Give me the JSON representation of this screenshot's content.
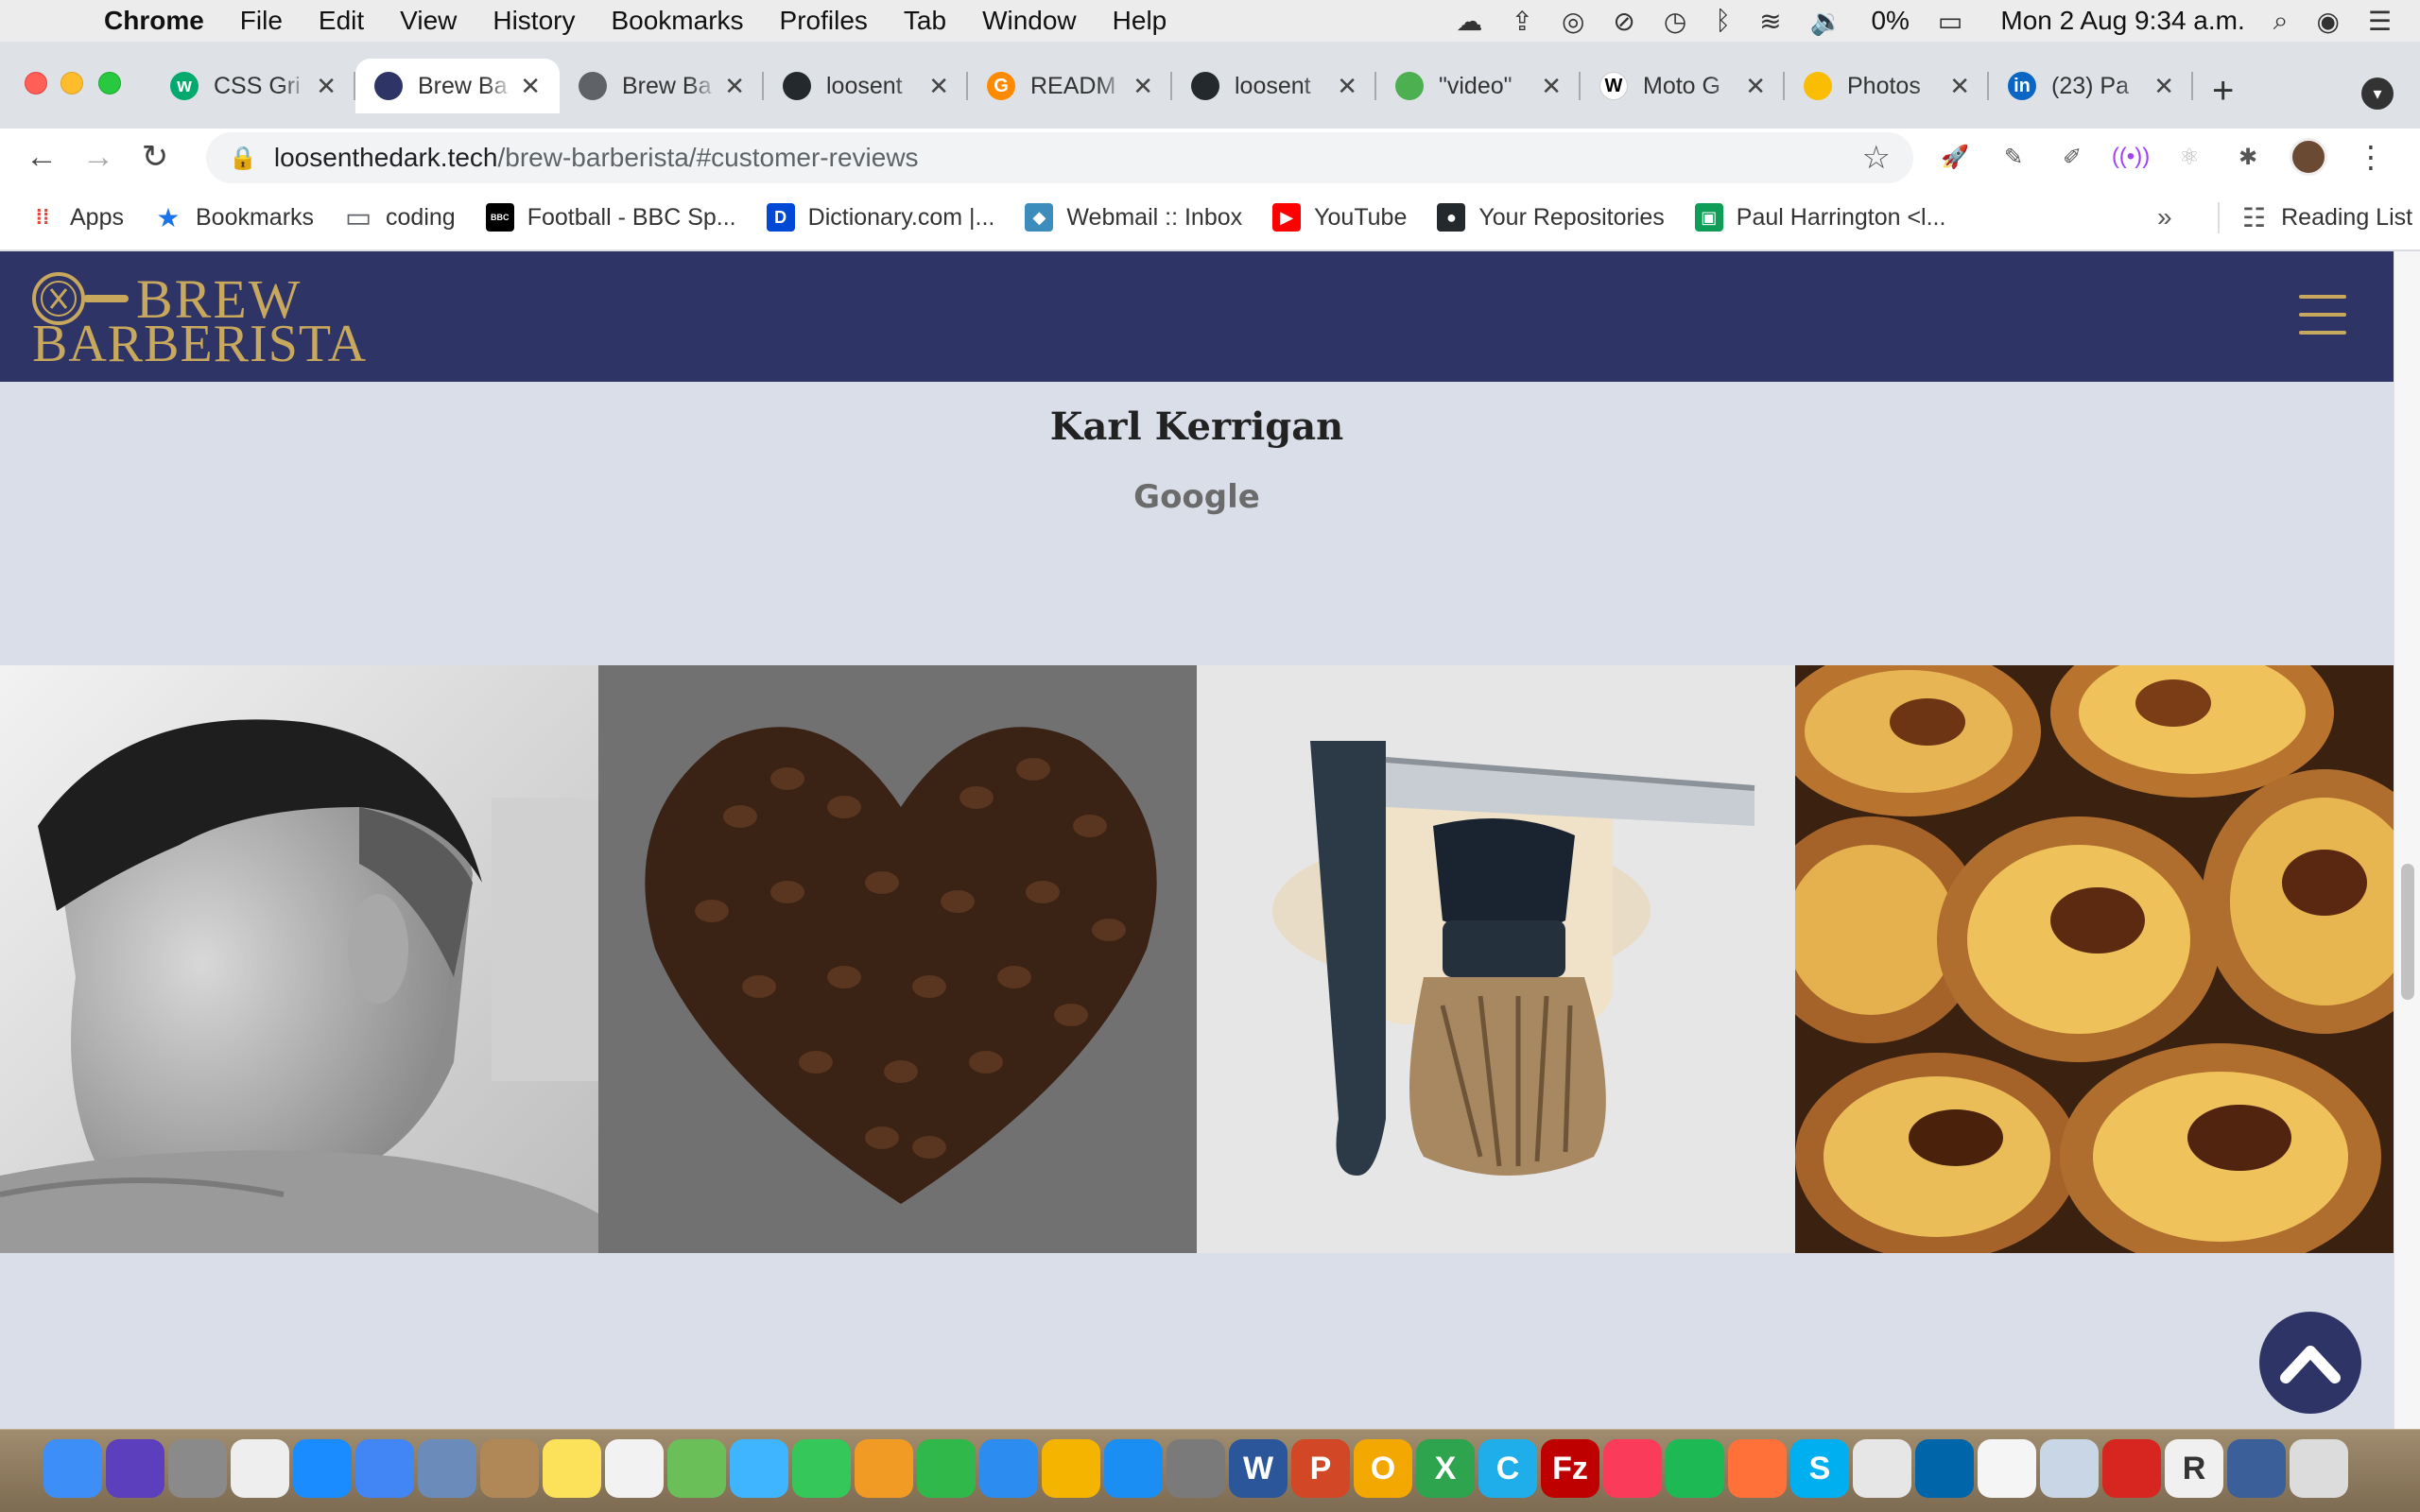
{
  "menubar": {
    "app_name": "Chrome",
    "items": [
      "File",
      "Edit",
      "View",
      "History",
      "Bookmarks",
      "Profiles",
      "Tab",
      "Window",
      "Help"
    ],
    "battery": "0%",
    "datetime": "Mon 2 Aug  9:34 a.m."
  },
  "tabs": [
    {
      "label": "CSS Gri",
      "icon": "w3schools-icon",
      "color": "#04aa6d",
      "glyph": "w"
    },
    {
      "label": "Brew Ba",
      "icon": "brew-barberista-icon",
      "color": "#2e3466",
      "glyph": "",
      "active": true
    },
    {
      "label": "Brew Ba",
      "icon": "globe-icon",
      "color": "#5f6368",
      "glyph": ""
    },
    {
      "label": "loosent",
      "icon": "github-icon",
      "color": "#24292e",
      "glyph": ""
    },
    {
      "label": "READM",
      "icon": "gitpod-icon",
      "color": "#ff8a00",
      "glyph": "G"
    },
    {
      "label": "loosent",
      "icon": "github-icon",
      "color": "#24292e",
      "glyph": ""
    },
    {
      "label": "\"video\"",
      "icon": "chart-icon",
      "color": "#4caf50",
      "glyph": ""
    },
    {
      "label": "Moto G",
      "icon": "wikipedia-icon",
      "color": "#ffffff",
      "glyph": "W"
    },
    {
      "label": "Photos",
      "icon": "google-photos-icon",
      "color": "#fbbc04",
      "glyph": ""
    },
    {
      "label": "(23) Pa",
      "icon": "linkedin-icon",
      "color": "#0a66c2",
      "glyph": "in"
    }
  ],
  "omnibox": {
    "host": "loosenthedark.tech",
    "path": "/brew-barberista/#customer-reviews"
  },
  "bookmarks": [
    {
      "label": "Apps",
      "icon": "apps-grid-icon",
      "color": "#ea4335"
    },
    {
      "label": "Bookmarks",
      "icon": "star-icon",
      "color": "#1a73e8"
    },
    {
      "label": "coding",
      "icon": "folder-icon",
      "color": "#5f6368"
    },
    {
      "label": "Football - BBC Sp...",
      "icon": "bbc-icon",
      "color": "#000000"
    },
    {
      "label": "Dictionary.com |...",
      "icon": "dictionary-icon",
      "color": "#0049d7"
    },
    {
      "label": "Webmail :: Inbox",
      "icon": "webmail-icon",
      "color": "#3c8dbc"
    },
    {
      "label": "YouTube",
      "icon": "youtube-icon",
      "color": "#ff0000"
    },
    {
      "label": "Your Repositories",
      "icon": "github-icon",
      "color": "#24292e"
    },
    {
      "label": "Paul Harrington <l...",
      "icon": "computer-icon",
      "color": "#0f9d58"
    }
  ],
  "reading_list": "Reading List",
  "site": {
    "logo_top": "BREW",
    "logo_bottom": "BARBERISTA",
    "brand_color": "#2e3466",
    "accent_color": "#c8a85c",
    "review_name": "Karl Kerrigan",
    "review_source": "Google",
    "gallery": [
      {
        "name": "gallery-image-haircut",
        "alt": "haircut"
      },
      {
        "name": "gallery-image-coffee-heart",
        "alt": "coffee-heart"
      },
      {
        "name": "gallery-image-shaving-kit",
        "alt": "shaving-kit"
      },
      {
        "name": "gallery-image-custard-tarts",
        "alt": "custard-tarts"
      }
    ]
  },
  "dock": [
    {
      "icon": "finder-icon",
      "color": "#3e8ef7"
    },
    {
      "icon": "siri-icon",
      "color": "#5b3fbd"
    },
    {
      "icon": "launchpad-icon",
      "color": "#8a8a8a"
    },
    {
      "icon": "apps-icon",
      "color": "#eeeeee"
    },
    {
      "icon": "safari-icon",
      "color": "#1a8cff"
    },
    {
      "icon": "chrome-icon",
      "color": "#4285f4"
    },
    {
      "icon": "preview-icon",
      "color": "#6b8cba"
    },
    {
      "icon": "contacts-icon",
      "color": "#b08858"
    },
    {
      "icon": "notes-icon",
      "color": "#fce25a"
    },
    {
      "icon": "reminders-icon",
      "color": "#f2f2f2"
    },
    {
      "icon": "maps-icon",
      "color": "#6bbf59"
    },
    {
      "icon": "messages-icon",
      "color": "#3fb5ff"
    },
    {
      "icon": "facetime-icon",
      "color": "#35c759"
    },
    {
      "icon": "pages-icon",
      "color": "#f29b24"
    },
    {
      "icon": "numbers-icon",
      "color": "#30b94a"
    },
    {
      "icon": "keynote-icon",
      "color": "#2d8cf0"
    },
    {
      "icon": "photos-icon",
      "color": "#f4b400"
    },
    {
      "icon": "app-store-icon",
      "color": "#1b8ef3"
    },
    {
      "icon": "system-preferences-icon",
      "color": "#7a7a7a"
    },
    {
      "icon": "word-icon",
      "color": "#2b579a",
      "glyph": "W"
    },
    {
      "icon": "powerpoint-icon",
      "color": "#d24726",
      "glyph": "P"
    },
    {
      "icon": "outlook-icon",
      "color": "#f2a800",
      "glyph": "O"
    },
    {
      "icon": "excel-icon",
      "color": "#2ea44f",
      "glyph": "X"
    },
    {
      "icon": "codeshot-icon",
      "color": "#1faee9",
      "glyph": "C"
    },
    {
      "icon": "filezilla-icon",
      "color": "#bf0000",
      "glyph": "Fz"
    },
    {
      "icon": "music-icon",
      "color": "#fa3c5a"
    },
    {
      "icon": "spotify-icon",
      "color": "#1db954"
    },
    {
      "icon": "firefox-icon",
      "color": "#ff7139"
    },
    {
      "icon": "skype-icon",
      "color": "#00aff0",
      "glyph": "S"
    },
    {
      "icon": "slack-icon",
      "color": "#e6e6e6"
    },
    {
      "icon": "vscode-icon",
      "color": "#0065a9"
    },
    {
      "icon": "textedit-icon",
      "color": "#f5f5f5"
    },
    {
      "icon": "preview-2-icon",
      "color": "#c9d6e6"
    },
    {
      "icon": "acrobat-icon",
      "color": "#d7261f"
    },
    {
      "icon": "r-icon",
      "color": "#f0f0f0",
      "glyph": "R"
    },
    {
      "icon": "downloads-icon",
      "color": "#3a5f99"
    },
    {
      "icon": "trash-icon",
      "color": "#dcdcdc"
    }
  ]
}
